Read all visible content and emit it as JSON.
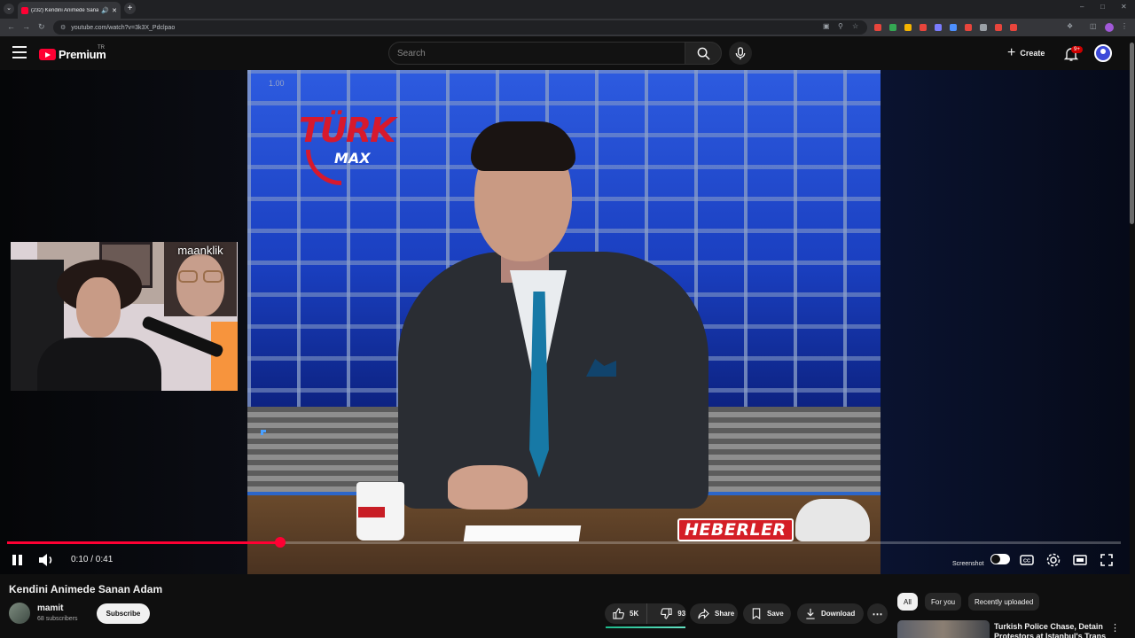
{
  "browser": {
    "tab_title": "(232) Kendini Animede Sanan Adam - YouTube",
    "url": "youtube.com/watch?v=3k3X_Pdclpao",
    "extension_colors": [
      "#e8453c",
      "#34a853",
      "#f4b400",
      "#e8453c",
      "#7a7cff",
      "#4d90fe",
      "#e8453c",
      "#9aa0a6",
      "#e8453c",
      "#e8453c"
    ]
  },
  "header": {
    "logo_text": "Premium",
    "country_code": "TR",
    "search_placeholder": "Search",
    "create_label": "Create",
    "notification_badge": "9+"
  },
  "player": {
    "speed_label": "1.00",
    "channel_overlay_name": "maanklik",
    "logo_top": "TÜRK",
    "logo_bottom": "MAX",
    "lower_third": "HEBERLER",
    "time_display": "0:10 / 0:41",
    "progress_fraction": 0.245,
    "screenshot_label": "Screenshot",
    "accent_color": "#ff0033"
  },
  "video": {
    "title": "Kendini Animede Sanan Adam",
    "channel_name": "mamit",
    "subscribers": "68 subscribers",
    "subscribe_label": "Subscribe",
    "likes": "5K",
    "dislikes": "93",
    "share_label": "Share",
    "save_label": "Save",
    "download_label": "Download"
  },
  "sidebar": {
    "chips": [
      {
        "label": "All",
        "active": true
      },
      {
        "label": "For you",
        "active": false
      },
      {
        "label": "Recently uploaded",
        "active": false
      }
    ],
    "recommendation_title": "Turkish Police Chase, Detain Protestors at Istanbul's Trans"
  }
}
